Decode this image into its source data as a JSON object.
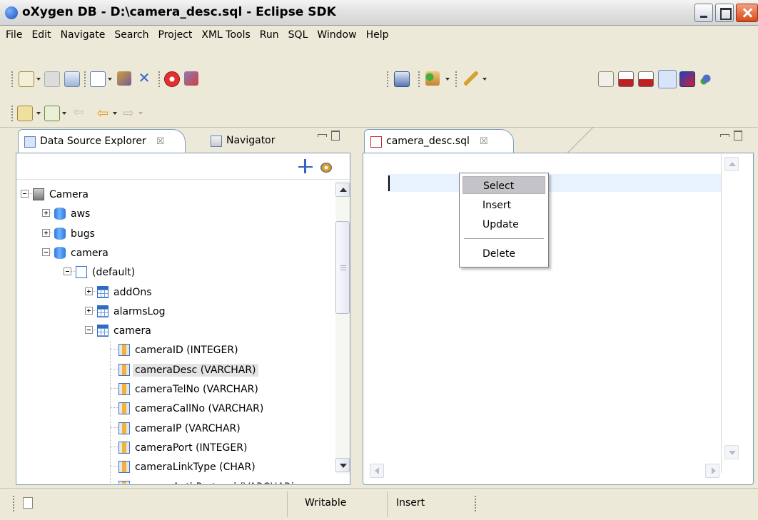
{
  "window": {
    "title": "oXygen DB - D:\\camera_desc.sql - Eclipse SDK"
  },
  "menu": [
    "File",
    "Edit",
    "Navigate",
    "Search",
    "Project",
    "XML Tools",
    "Run",
    "SQL",
    "Window",
    "Help"
  ],
  "left_panel": {
    "tabs": [
      {
        "label": "Data Source Explorer",
        "close": "☒",
        "icon": "data-source-explorer-icon"
      },
      {
        "label": "Navigator",
        "icon": "navigator-icon"
      }
    ],
    "tree": [
      {
        "label": "Camera",
        "icon": "server",
        "expander": "minus"
      },
      {
        "label": "aws",
        "icon": "database",
        "expander": "plus"
      },
      {
        "label": "bugs",
        "icon": "database",
        "expander": "plus"
      },
      {
        "label": "camera",
        "icon": "database",
        "expander": "minus"
      },
      {
        "label": "(default)",
        "icon": "schema",
        "expander": "minus"
      },
      {
        "label": "addOns",
        "icon": "table",
        "expander": "plus"
      },
      {
        "label": "alarmsLog",
        "icon": "table",
        "expander": "plus"
      },
      {
        "label": "camera",
        "icon": "table",
        "expander": "minus"
      },
      {
        "label": "cameraID (INTEGER)",
        "icon": "column"
      },
      {
        "label": "cameraDesc (VARCHAR)",
        "icon": "column",
        "selected": true
      },
      {
        "label": "cameraTelNo (VARCHAR)",
        "icon": "column"
      },
      {
        "label": "cameraCallNo (VARCHAR)",
        "icon": "column"
      },
      {
        "label": "cameraIP (VARCHAR)",
        "icon": "column"
      },
      {
        "label": "cameraPort (INTEGER)",
        "icon": "column"
      },
      {
        "label": "cameraLinkType (CHAR)",
        "icon": "column"
      },
      {
        "label": "cameraAuthProtocol (VARCHAR)",
        "icon": "column"
      }
    ]
  },
  "editor": {
    "tab_label": "camera_desc.sql",
    "tab_close": "☒",
    "context_menu": [
      "Select",
      "Insert",
      "Update",
      "Delete"
    ]
  },
  "status": {
    "mode": "Writable",
    "insert": "Insert"
  },
  "colors": {
    "selection": "#c4c4c8",
    "current_line": "#e8f2fe",
    "panel_border": "#7f9db9",
    "chrome": "#ece9d8"
  }
}
